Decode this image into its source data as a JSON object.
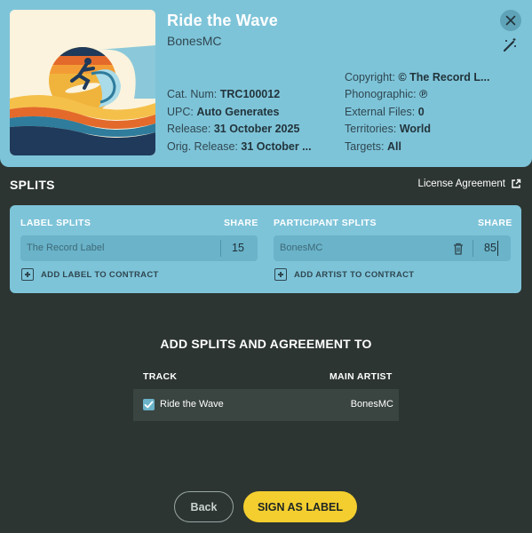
{
  "release": {
    "title": "Ride the Wave",
    "artist": "BonesMC",
    "cat_num_label": "Cat. Num:",
    "cat_num": "TRC100012",
    "upc_label": "UPC:",
    "upc": "Auto Generates",
    "release_label": "Release:",
    "release_date": "31 October 2025",
    "orig_release_label": "Orig. Release:",
    "orig_release_date": "31 October ...",
    "copyright_label": "Copyright:",
    "copyright": "© The Record L...",
    "phonographic_label": "Phonographic:",
    "phonographic": "℗",
    "external_files_label": "External Files:",
    "external_files": "0",
    "territories_label": "Territories:",
    "territories": "World",
    "targets_label": "Targets:",
    "targets": "All"
  },
  "header_icons": {
    "close": "close-icon",
    "edit": "magic-wand-icon"
  },
  "splits": {
    "section_title": "SPLITS",
    "license_link": "License Agreement",
    "label_header": "LABEL SPLITS",
    "label_share_header": "SHARE",
    "label_rows": [
      {
        "name": "The Record Label",
        "share": "15"
      }
    ],
    "add_label": "ADD LABEL TO CONTRACT",
    "participant_header": "PARTICIPANT SPLITS",
    "participant_share_header": "SHARE",
    "participant_rows": [
      {
        "name": "BonesMC",
        "share": "85"
      }
    ],
    "add_artist": "ADD ARTIST TO CONTRACT"
  },
  "agreement": {
    "title": "ADD SPLITS AND AGREEMENT TO",
    "track_header": "TRACK",
    "artist_header": "MAIN ARTIST",
    "tracks": [
      {
        "checked": true,
        "name": "Ride the Wave",
        "artist": "BonesMC"
      }
    ]
  },
  "buttons": {
    "back": "Back",
    "sign": "SIGN AS LABEL"
  },
  "colors": {
    "panel": "#7ec4d9",
    "background": "#2c3532",
    "accent_button": "#f4ce2f"
  }
}
